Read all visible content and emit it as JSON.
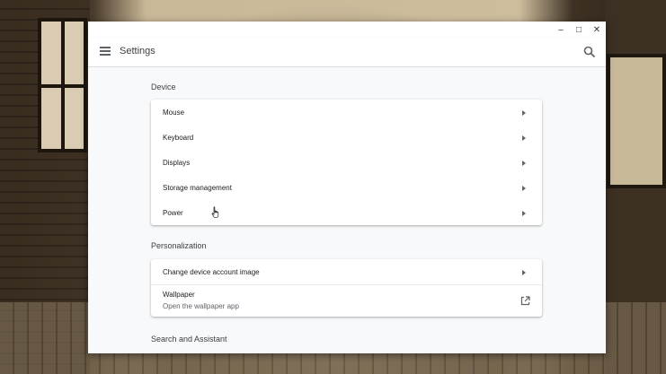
{
  "window": {
    "title": "Settings"
  },
  "controls": {
    "minimize": "–",
    "maximize": "□",
    "close": "✕"
  },
  "icons": {
    "menu": "menu-icon",
    "search": "search-icon",
    "external": "open-in-new-icon",
    "cursor": "hand-pointer-icon"
  },
  "sections": {
    "device": {
      "title": "Device",
      "items": [
        {
          "label": "Mouse"
        },
        {
          "label": "Keyboard"
        },
        {
          "label": "Displays"
        },
        {
          "label": "Storage management"
        },
        {
          "label": "Power"
        }
      ]
    },
    "personalization": {
      "title": "Personalization",
      "items": [
        {
          "label": "Change device account image"
        },
        {
          "label": "Wallpaper",
          "sublabel": "Open the wallpaper app"
        }
      ]
    },
    "search": {
      "title": "Search and Assistant"
    }
  },
  "colors": {
    "accent": "#5f6368",
    "background": "#f8f9fa",
    "card": "#ffffff"
  }
}
